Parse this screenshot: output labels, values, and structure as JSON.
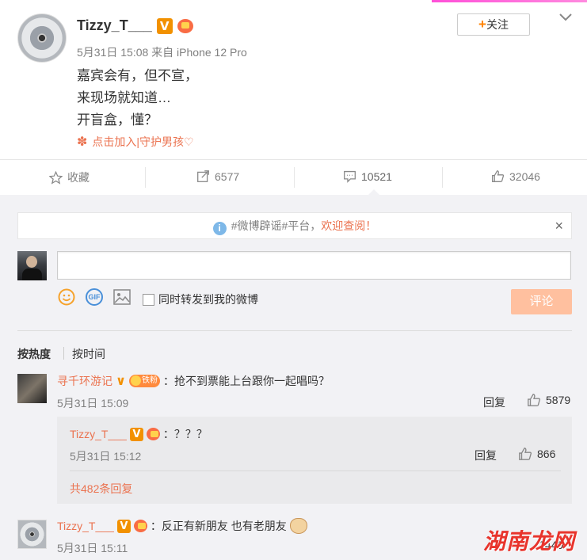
{
  "post": {
    "username": "Tizzy_T___",
    "verified_badge": "V",
    "meta": "5月31日 15:08 来自 iPhone 12 Pro",
    "lines": [
      "嘉宾会有，但不宣，",
      "来现场就知道…",
      "开盲盒，懂？"
    ],
    "tag_link": "点击加入|守护男孩♡",
    "follow_label": "关注",
    "follow_plus": "+"
  },
  "actions": {
    "favorite": "收藏",
    "repost": "6577",
    "comment": "10521",
    "like": "32046"
  },
  "notice": {
    "text": "#微博辟谣#平台，",
    "link": "欢迎查阅！",
    "close": "×"
  },
  "composer": {
    "placeholder": "",
    "repost_label": "同时转发到我的微博",
    "submit_label": "评论"
  },
  "sort": {
    "hot": "按热度",
    "time": "按时间"
  },
  "comments": [
    {
      "name": "寻千环游记",
      "fan_badge": "铁粉",
      "text": "：抢不到票能上台跟你一起唱吗？",
      "time": "5月31日 15:09",
      "reply": "回复",
      "likes": "5879",
      "sub": {
        "name": "Tizzy_T___",
        "text": "：？？？",
        "time": "5月31日 15:12",
        "reply": "回复",
        "likes": "866"
      },
      "more": "共482条回复"
    },
    {
      "name": "Tizzy_T___",
      "text": "：反正有新朋友 也有老朋友",
      "time": "5月31日 15:11",
      "likes": "2449"
    }
  ],
  "watermark": "湖南龙网",
  "colors": {
    "accent": "#eb7350",
    "vip": "#f29100",
    "submit": "#ffc09f",
    "panel": "#f2f2f5"
  }
}
